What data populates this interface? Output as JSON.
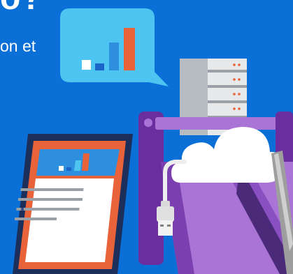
{
  "banner": {
    "heading_fragment": "o?",
    "body_fragment": "on et"
  },
  "colors": {
    "background": "#0a6fd6",
    "bubble": "#4dc5f0",
    "bar_dark": "#1a66c8",
    "bar_blue": "#2f8fdf",
    "bar_orange": "#e8623a",
    "server": "#e4e4e4",
    "basket": "#7b3fb0",
    "basket_light": "#a974d6",
    "cloud": "#ffffff",
    "tablet_frame": "#1c2f5a",
    "tablet_orange": "#e8623a"
  },
  "icons": {
    "chart_bubble": "bar-chart-icon",
    "server": "server-rack-icon",
    "cloud": "cloud-icon",
    "usb": "usb-plug-icon",
    "tablet": "tablet-document-icon",
    "basket": "basket-icon"
  }
}
